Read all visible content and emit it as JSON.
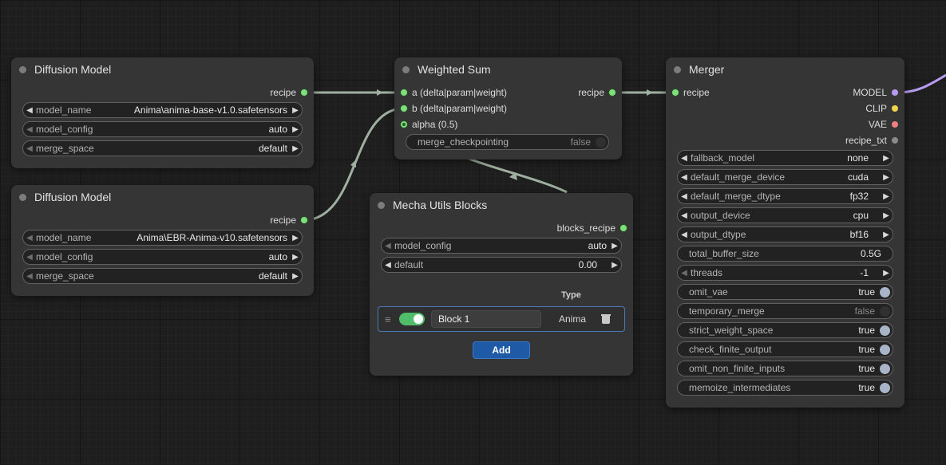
{
  "nodes": {
    "dm1": {
      "title": "Diffusion Model",
      "output": "recipe",
      "widgets": [
        {
          "label": "model_name",
          "value": "Anima\\anima-base-v1.0.safetensors"
        },
        {
          "label": "model_config",
          "value": "auto"
        },
        {
          "label": "merge_space",
          "value": "default"
        }
      ]
    },
    "dm2": {
      "title": "Diffusion Model",
      "output": "recipe",
      "widgets": [
        {
          "label": "model_name",
          "value": "Anima\\EBR-Anima-v10.safetensors"
        },
        {
          "label": "model_config",
          "value": "auto"
        },
        {
          "label": "merge_space",
          "value": "default"
        }
      ]
    },
    "ws": {
      "title": "Weighted Sum",
      "inputs": [
        "a (delta|param|weight)",
        "b (delta|param|weight)",
        "alpha (0.5)"
      ],
      "output": "recipe",
      "toggle": {
        "label": "merge_checkpointing",
        "value": "false"
      }
    },
    "mu": {
      "title": "Mecha Utils Blocks",
      "output": "blocks_recipe",
      "widgets": [
        {
          "label": "model_config",
          "value": "auto"
        },
        {
          "label": "default",
          "value": "0.00"
        }
      ],
      "type_header": "Type",
      "block": {
        "name": "Block 1",
        "type": "Anima"
      },
      "add_label": "Add"
    },
    "mg": {
      "title": "Merger",
      "input": "recipe",
      "outputs": [
        "MODEL",
        "CLIP",
        "VAE",
        "recipe_txt"
      ],
      "combos": [
        {
          "label": "fallback_model",
          "value": "none"
        },
        {
          "label": "default_merge_device",
          "value": "cuda"
        },
        {
          "label": "default_merge_dtype",
          "value": "fp32"
        },
        {
          "label": "output_device",
          "value": "cpu"
        },
        {
          "label": "output_dtype",
          "value": "bf16"
        }
      ],
      "buffer": {
        "label": "total_buffer_size",
        "value": "0.5G"
      },
      "threads": {
        "label": "threads",
        "value": "-1"
      },
      "toggles": [
        {
          "label": "omit_vae",
          "value": "true"
        },
        {
          "label": "temporary_merge",
          "value": "false"
        },
        {
          "label": "strict_weight_space",
          "value": "true"
        },
        {
          "label": "check_finite_output",
          "value": "true"
        },
        {
          "label": "omit_non_finite_inputs",
          "value": "true"
        },
        {
          "label": "memoize_intermediates",
          "value": "true"
        }
      ]
    }
  },
  "colors": {
    "wire": "#9fb0a0",
    "model_wire": "#b69cf0",
    "socket_green": "#7ee07a",
    "accent_blue": "#1f5aa6"
  }
}
